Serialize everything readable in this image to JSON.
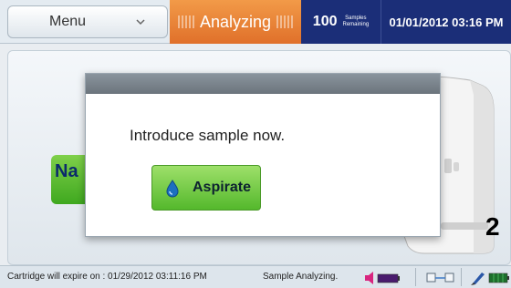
{
  "topbar": {
    "menu_label": "Menu",
    "status_label": "Analyzing",
    "samples_count": "100",
    "samples_label_line1": "Samples",
    "samples_label_line2": "Remaining",
    "datetime": "01/01/2012 03:16 PM"
  },
  "background": {
    "partial_button_label": "Na"
  },
  "dialog": {
    "message": "Introduce sample now.",
    "aspirate_label": "Aspirate"
  },
  "marker": "2",
  "statusbar": {
    "cartridge_expiry": "Cartridge will expire on : 01/29/2012 03:11:16 PM",
    "status": "Sample Analyzing."
  },
  "icons": {
    "chevron": "chevron-down-icon",
    "drop": "water-drop-icon",
    "speaker": "speaker-icon",
    "network": "network-icon",
    "pen": "pen-icon",
    "battery": "battery-icon"
  },
  "colors": {
    "status_orange": "#e87d35",
    "header_navy": "#1b2e78",
    "button_green": "#6cc83e"
  }
}
